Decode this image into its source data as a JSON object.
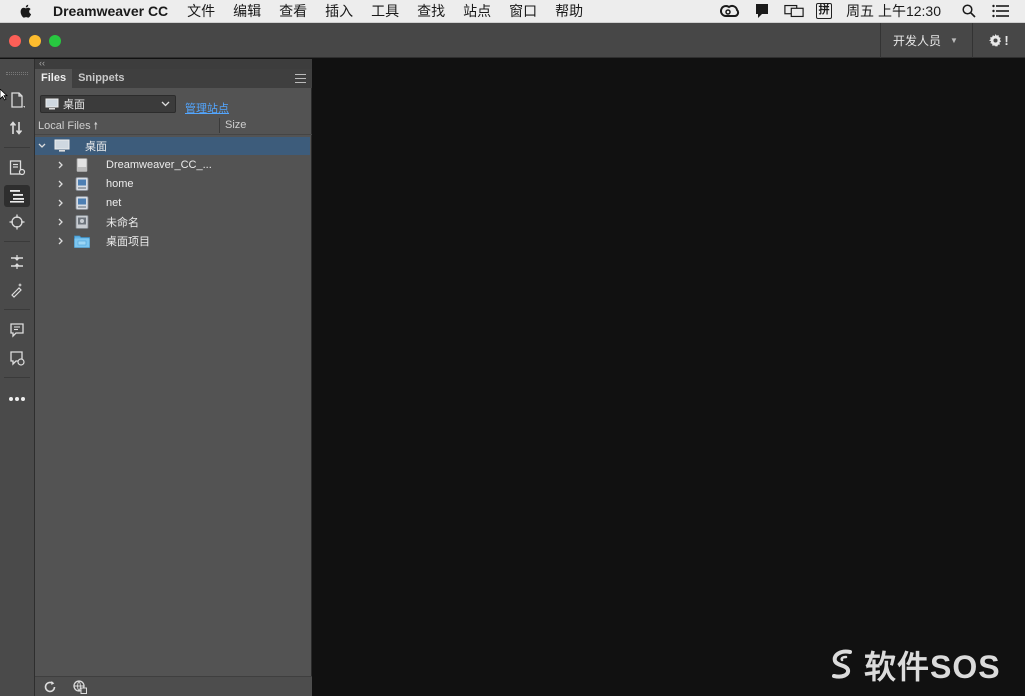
{
  "menubar": {
    "app_name": "Dreamweaver CC",
    "items": [
      "文件",
      "编辑",
      "查看",
      "插入",
      "工具",
      "查找",
      "站点",
      "窗口",
      "帮助"
    ],
    "clock": "周五 上午12:30",
    "ime_label": "拼"
  },
  "titlebar": {
    "workspace_label": "开发人员",
    "settings_label": "!"
  },
  "panel": {
    "tabs": [
      "Files",
      "Snippets"
    ],
    "site_select": "桌面",
    "manage_link": "管理站点",
    "col_local": "Local Files",
    "col_size": "Size",
    "tree": [
      {
        "name": "桌面",
        "type": "computer",
        "expanded": true,
        "level": 0
      },
      {
        "name": "Dreamweaver_CC_...",
        "type": "drive",
        "level": 1
      },
      {
        "name": "home",
        "type": "network",
        "level": 1
      },
      {
        "name": "net",
        "type": "network",
        "level": 1
      },
      {
        "name": "未命名",
        "type": "disk",
        "level": 1
      },
      {
        "name": "桌面项目",
        "type": "folder",
        "level": 1
      }
    ]
  },
  "watermark": {
    "text": "软件SOS"
  },
  "colors": {
    "selection": "#3d5c7b",
    "link": "#53a6ff",
    "panel_bg": "#535353",
    "doc_bg": "#111111"
  }
}
